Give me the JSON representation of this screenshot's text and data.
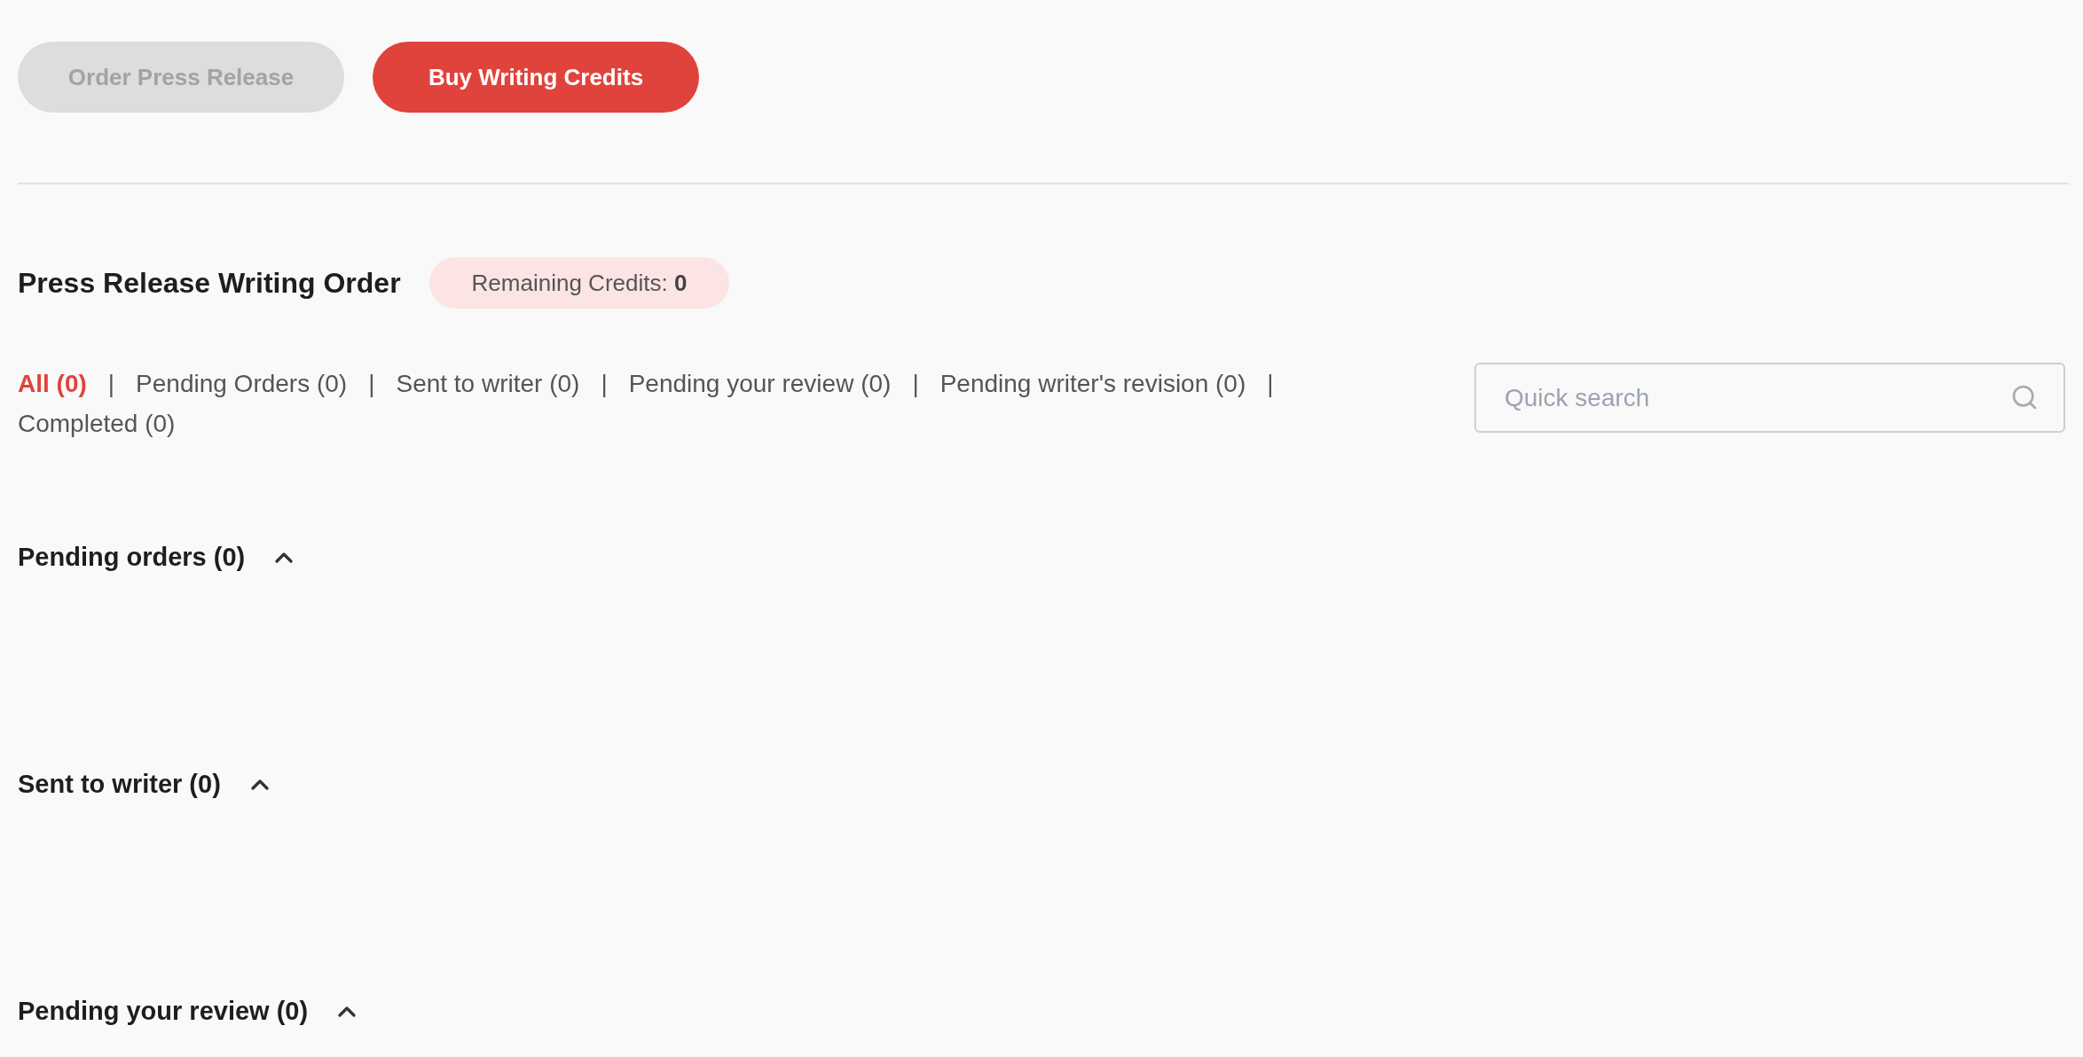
{
  "actions": [
    {
      "label": "Order Press Release",
      "disabled": true
    },
    {
      "label": "Buy Writing Credits",
      "disabled": false
    }
  ],
  "title": "Press Release Writing Order",
  "credits": {
    "label": "Remaining Credits:",
    "value": "0"
  },
  "filters": [
    {
      "label": "All (0)",
      "selected": true
    },
    {
      "label": "Pending Orders (0)",
      "selected": false
    },
    {
      "label": "Sent to writer (0)",
      "selected": false
    },
    {
      "label": "Pending your review (0)",
      "selected": false
    },
    {
      "label": "Pending writer's revision (0)",
      "selected": false
    },
    {
      "label": "Completed (0)",
      "selected": false
    }
  ],
  "separator": "|",
  "search": {
    "placeholder": "Quick search"
  },
  "sections": [
    {
      "title": "Pending orders (0)",
      "expanded": true
    },
    {
      "title": "Sent to writer (0)",
      "expanded": true
    },
    {
      "title": "Pending your review (0)",
      "expanded": true
    }
  ]
}
